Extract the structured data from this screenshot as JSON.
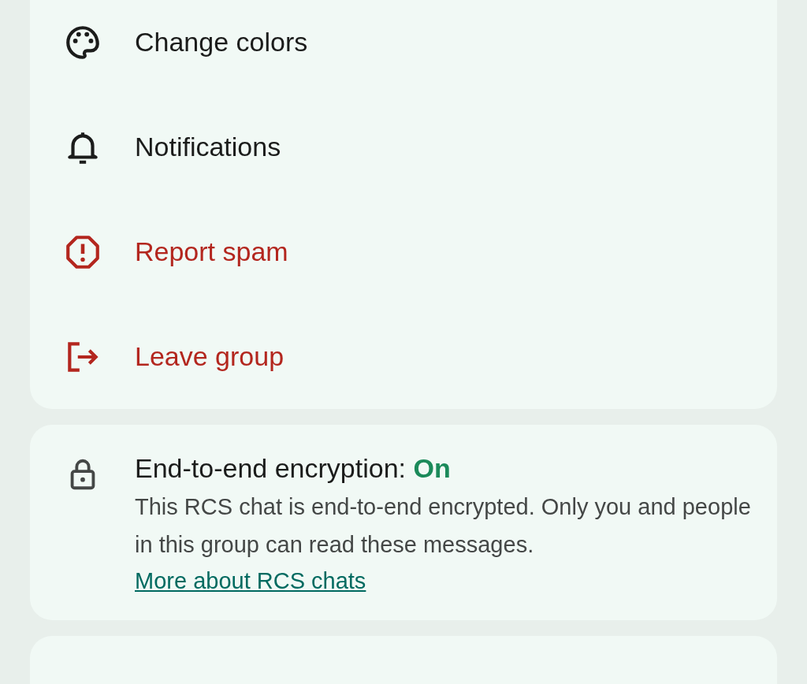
{
  "options": [
    {
      "label": "Change colors",
      "kind": "default"
    },
    {
      "label": "Notifications",
      "kind": "default"
    },
    {
      "label": "Report spam",
      "kind": "destructive"
    },
    {
      "label": "Leave group",
      "kind": "destructive"
    }
  ],
  "encryption": {
    "title": "End-to-end encryption:",
    "status": "On",
    "on": true,
    "description": "This RCS chat is end-to-end encrypted. Only you and people in this group can read these messages.",
    "link": "More about RCS chats"
  }
}
